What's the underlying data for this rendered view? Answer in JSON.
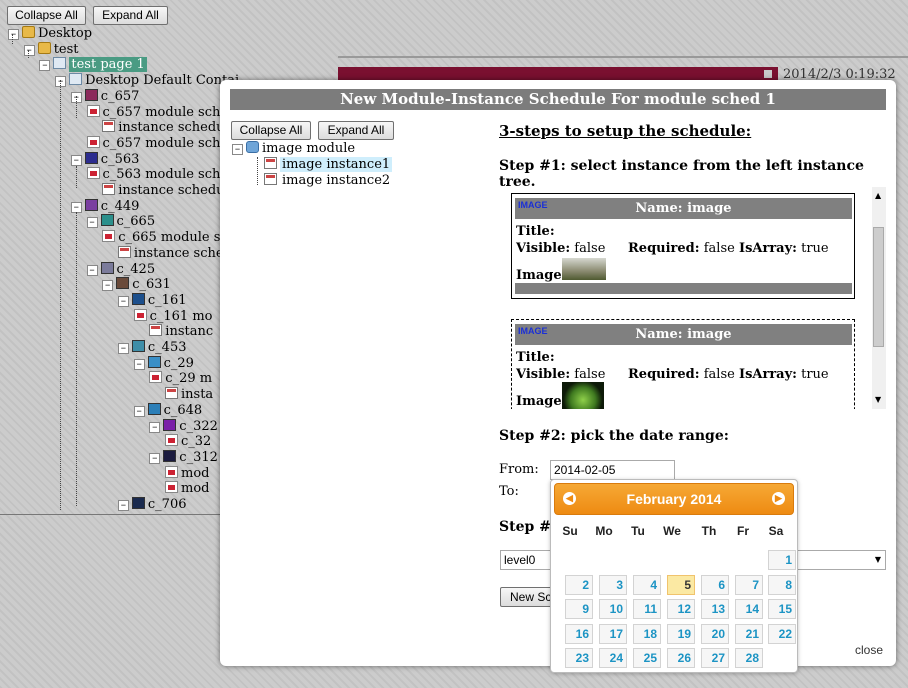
{
  "toolbar": {
    "collapse_all": "Collapse All",
    "expand_all": "Expand All"
  },
  "bg_tree": [
    {
      "label": "Desktop",
      "indent": 0,
      "icon": "folder"
    },
    {
      "label": "test",
      "indent": 1,
      "icon": "folder"
    },
    {
      "label": "test page 1",
      "indent": 2,
      "icon": "page",
      "selected": true
    },
    {
      "label": "Desktop Default Contai",
      "indent": 3,
      "icon": "page"
    },
    {
      "label": "c_657",
      "indent": 4,
      "icon": "sq",
      "color": "#8b2a5b"
    },
    {
      "label": "c_657 module sche",
      "indent": 5,
      "icon": "mod"
    },
    {
      "label": "instance schedu",
      "indent": 6,
      "icon": "doc"
    },
    {
      "label": "c_657 module sch",
      "indent": 5,
      "icon": "mod"
    },
    {
      "label": "c_563",
      "indent": 4,
      "icon": "sq",
      "color": "#2c2c8e"
    },
    {
      "label": "c_563 module sch",
      "indent": 5,
      "icon": "mod"
    },
    {
      "label": "instance schedu",
      "indent": 6,
      "icon": "doc"
    },
    {
      "label": "c_449",
      "indent": 4,
      "icon": "sq",
      "color": "#7a3fa0"
    },
    {
      "label": "c_665",
      "indent": 5,
      "icon": "sq",
      "color": "#2b8f8b"
    },
    {
      "label": "c_665 module s",
      "indent": 6,
      "icon": "mod"
    },
    {
      "label": "instance sche",
      "indent": 7,
      "icon": "doc"
    },
    {
      "label": "c_425",
      "indent": 5,
      "icon": "sq",
      "color": "#7b7b9b"
    },
    {
      "label": "c_631",
      "indent": 6,
      "icon": "sq",
      "color": "#6a4a3a"
    },
    {
      "label": "c_161",
      "indent": 7,
      "icon": "sq",
      "color": "#1c4f8c"
    },
    {
      "label": "c_161 mo",
      "indent": 8,
      "icon": "mod"
    },
    {
      "label": "instanc",
      "indent": 9,
      "icon": "doc"
    },
    {
      "label": "c_453",
      "indent": 7,
      "icon": "sq",
      "color": "#3f8ea8"
    },
    {
      "label": "c_29",
      "indent": 8,
      "icon": "sq",
      "color": "#3a8fc7"
    },
    {
      "label": "c_29 m",
      "indent": 9,
      "icon": "mod"
    },
    {
      "label": "insta",
      "indent": 10,
      "icon": "doc"
    },
    {
      "label": "c_648",
      "indent": 8,
      "icon": "sq",
      "color": "#2c7fb8"
    },
    {
      "label": "c_322",
      "indent": 9,
      "icon": "sq",
      "color": "#7a1fa8"
    },
    {
      "label": "c_32",
      "indent": 10,
      "icon": "mod"
    },
    {
      "label": "c_312",
      "indent": 9,
      "icon": "sq",
      "color": "#1a1a3e"
    },
    {
      "label": "mod",
      "indent": 10,
      "icon": "mod"
    },
    {
      "label": "mod",
      "indent": 10,
      "icon": "mod"
    },
    {
      "label": "c_706",
      "indent": 7,
      "icon": "sq",
      "color": "#1a2a4e"
    }
  ],
  "bg_timestamp": "2014/2/3 0:19:32",
  "dialog": {
    "title": "New Module-Instance Schedule For module sched 1",
    "collapse_all": "Collapse All",
    "expand_all": "Expand All",
    "tree": {
      "root": "image module",
      "children": [
        "image instance1",
        "image instance2"
      ]
    },
    "heading": "3-steps to setup the schedule:",
    "step1": "Step #1: select instance from the left instance tree.",
    "cards": [
      {
        "tag": "IMAGE",
        "name": "Name: image",
        "title_label": "Title:",
        "visible_label": "Visible:",
        "visible": "false",
        "required_label": "Required:",
        "required": "false",
        "isarray_label": "IsArray:",
        "isarray": "true",
        "image_label": "Image:"
      },
      {
        "tag": "IMAGE",
        "name": "Name: image",
        "title_label": "Title:",
        "visible_label": "Visible:",
        "visible": "false",
        "required_label": "Required:",
        "required": "false",
        "isarray_label": "IsArray:",
        "isarray": "true",
        "image_label": "Image:"
      }
    ],
    "step2": "Step #2: pick the date range:",
    "from_label": "From:",
    "from_value": "2014-02-05",
    "to_label": "To:",
    "step3": "Step #3",
    "level_value": "level0",
    "new_button": "New Sc",
    "close": "close"
  },
  "calendar": {
    "title": "February 2014",
    "prev_icon": "prev-arrow-icon",
    "next_icon": "next-arrow-icon",
    "weekdays": [
      "Su",
      "Mo",
      "Tu",
      "We",
      "Th",
      "Fr",
      "Sa"
    ],
    "weeks": [
      [
        "",
        "",
        "",
        "",
        "",
        "",
        "1"
      ],
      [
        "2",
        "3",
        "4",
        "5",
        "6",
        "7",
        "8"
      ],
      [
        "9",
        "10",
        "11",
        "12",
        "13",
        "14",
        "15"
      ],
      [
        "16",
        "17",
        "18",
        "19",
        "20",
        "21",
        "22"
      ],
      [
        "23",
        "24",
        "25",
        "26",
        "27",
        "28",
        ""
      ]
    ],
    "today": "5"
  }
}
